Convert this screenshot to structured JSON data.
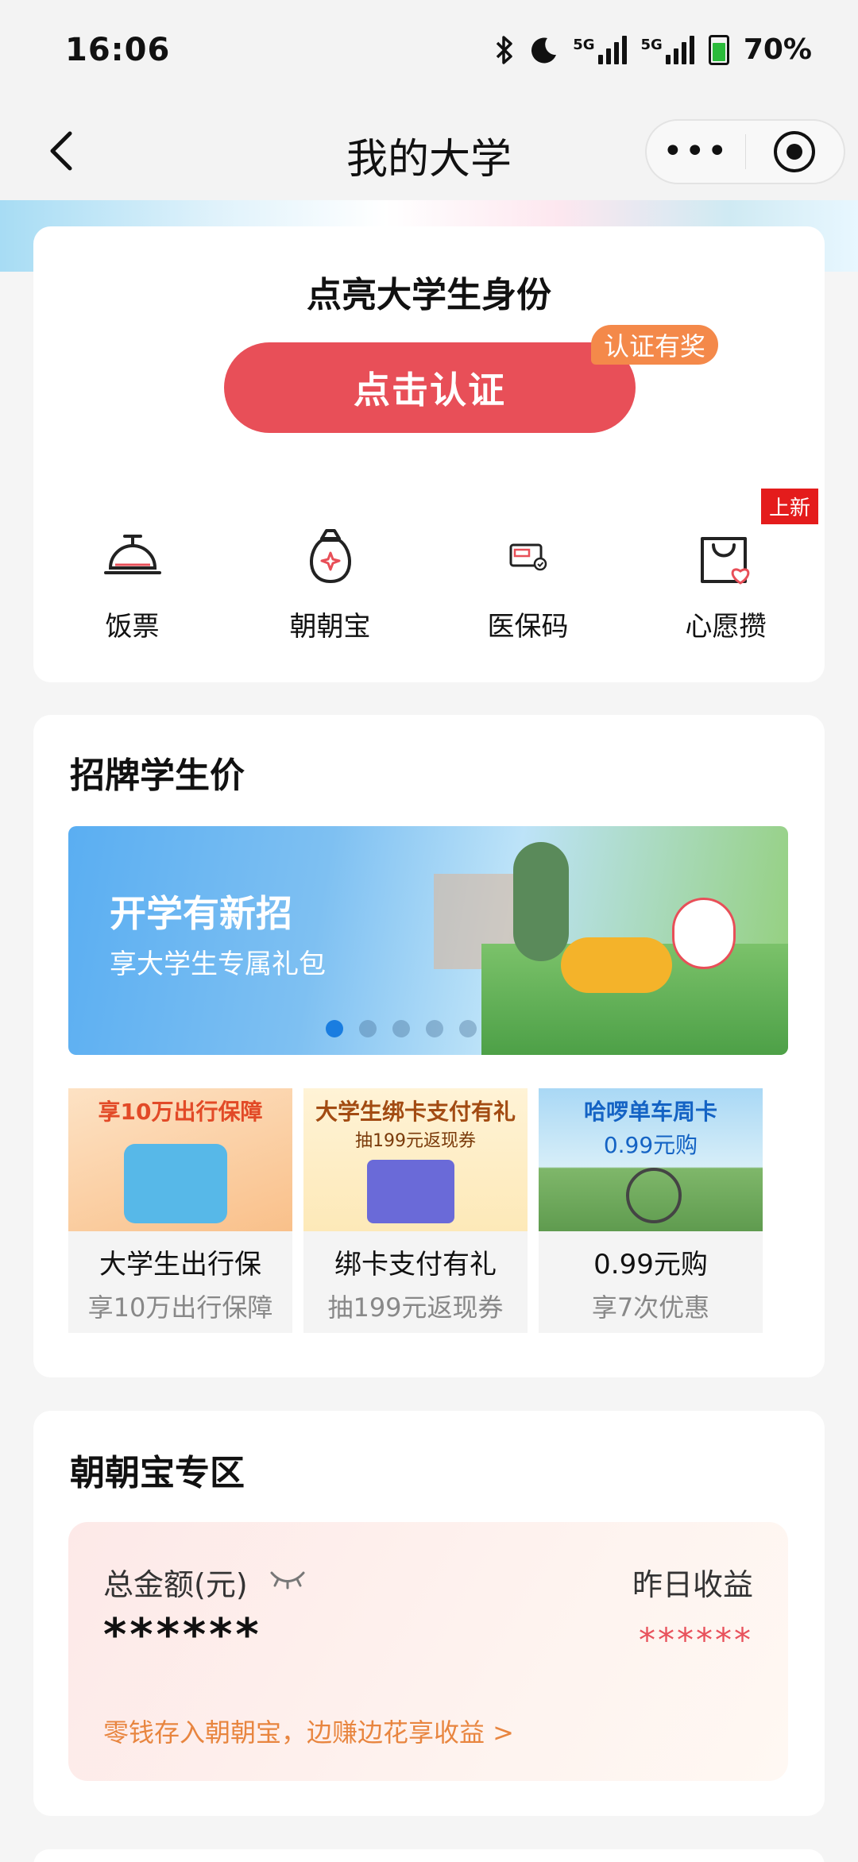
{
  "status": {
    "time": "16:06",
    "battery": "70%",
    "net1": "5G",
    "net2": "5G"
  },
  "nav": {
    "title": "我的大学",
    "more": "•••"
  },
  "identity": {
    "title": "点亮大学生身份",
    "button": "点击认证",
    "badge": "认证有奖"
  },
  "quick": [
    {
      "label": "饭票",
      "icon": "food-cloche-icon"
    },
    {
      "label": "朝朝宝",
      "icon": "money-bag-icon"
    },
    {
      "label": "医保码",
      "icon": "medical-insurance-card-icon"
    },
    {
      "label": "心愿攒",
      "icon": "shopping-bag-heart-icon",
      "badge": "上新"
    }
  ],
  "student_price": {
    "title": "招牌学生价",
    "banner": {
      "title": "开学有新招",
      "subtitle": "享大学生专属礼包",
      "pages": 5,
      "current": 1
    },
    "tiles": [
      {
        "img_title": "享10万出行保障",
        "title": "大学生出行保",
        "sub": "享10万出行保障"
      },
      {
        "img_title": "大学生绑卡支付有礼",
        "img_sub": "抽199元返现券",
        "title": "绑卡支付有礼",
        "sub": "抽199元返现券"
      },
      {
        "img_title": "哈啰单车周卡",
        "img_sub": "0.99元购",
        "title": "0.99元购",
        "sub": "享7次优惠"
      }
    ]
  },
  "zhaozhaobao": {
    "title": "朝朝宝专区",
    "total_label": "总金额(元)",
    "total_value": "******",
    "yesterday_label": "昨日收益",
    "yesterday_value": "******",
    "link": "零钱存入朝朝宝，边赚边花享收益 >"
  },
  "colors": {
    "accent": "#e84f58",
    "badge_orange": "#f4894a",
    "link_orange": "#e8853f",
    "new_red": "#e41c1c"
  }
}
